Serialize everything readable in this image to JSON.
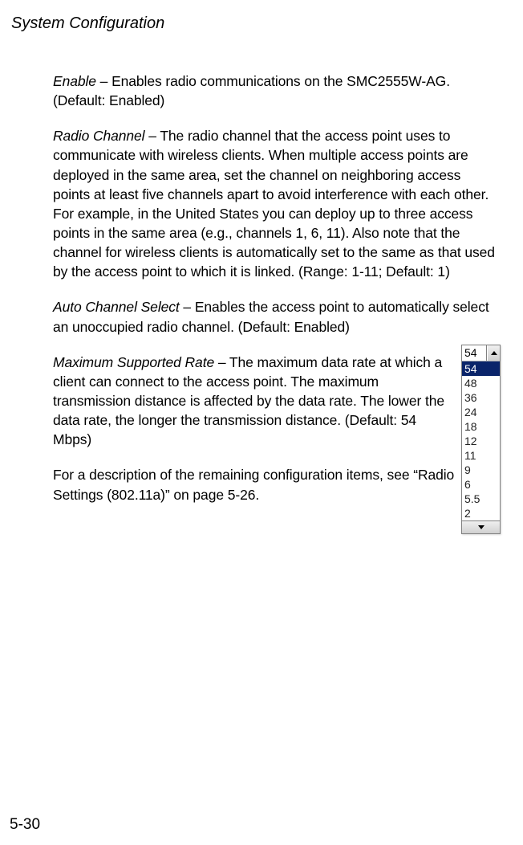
{
  "header": {
    "title": "System Configuration"
  },
  "paragraphs": {
    "enable": {
      "term": "Enable",
      "text": " – Enables radio communications on the SMC2555W-AG. (Default: Enabled)"
    },
    "radio_channel": {
      "term": "Radio Channel",
      "text": " – The radio channel that the access point uses to communicate with wireless clients. When multiple access points are deployed in the same area, set the channel on neighboring access points at least five channels apart to avoid interference with each other. For example, in the United States you can deploy up to three access points in the same area (e.g., channels 1, 6, 11). Also note that the channel for wireless clients is automatically set to the same as that used by the access point to which it is linked. (Range: 1-11; Default: 1)"
    },
    "auto_channel": {
      "term": "Auto Channel Select",
      "text": " – Enables the access point to automatically select an unoccupied radio channel. (Default: Enabled)"
    },
    "max_rate": {
      "term": "Maximum Supported Rate",
      "text": " – The maximum data rate at which a client can connect to the access point. The maximum transmission distance is affected by the data rate. The lower the data rate, the longer the transmission distance. (Default: 54 Mbps)"
    },
    "remaining": {
      "text": "For a description of the remaining configuration items, see “Radio Settings (802.11a)” on page 5-26."
    }
  },
  "dropdown": {
    "top_value": "54",
    "selected": "54",
    "items": [
      "54",
      "48",
      "36",
      "24",
      "18",
      "12",
      "11",
      "9",
      "6",
      "5.5",
      "2"
    ]
  },
  "footer": {
    "page_number": "5-30"
  }
}
